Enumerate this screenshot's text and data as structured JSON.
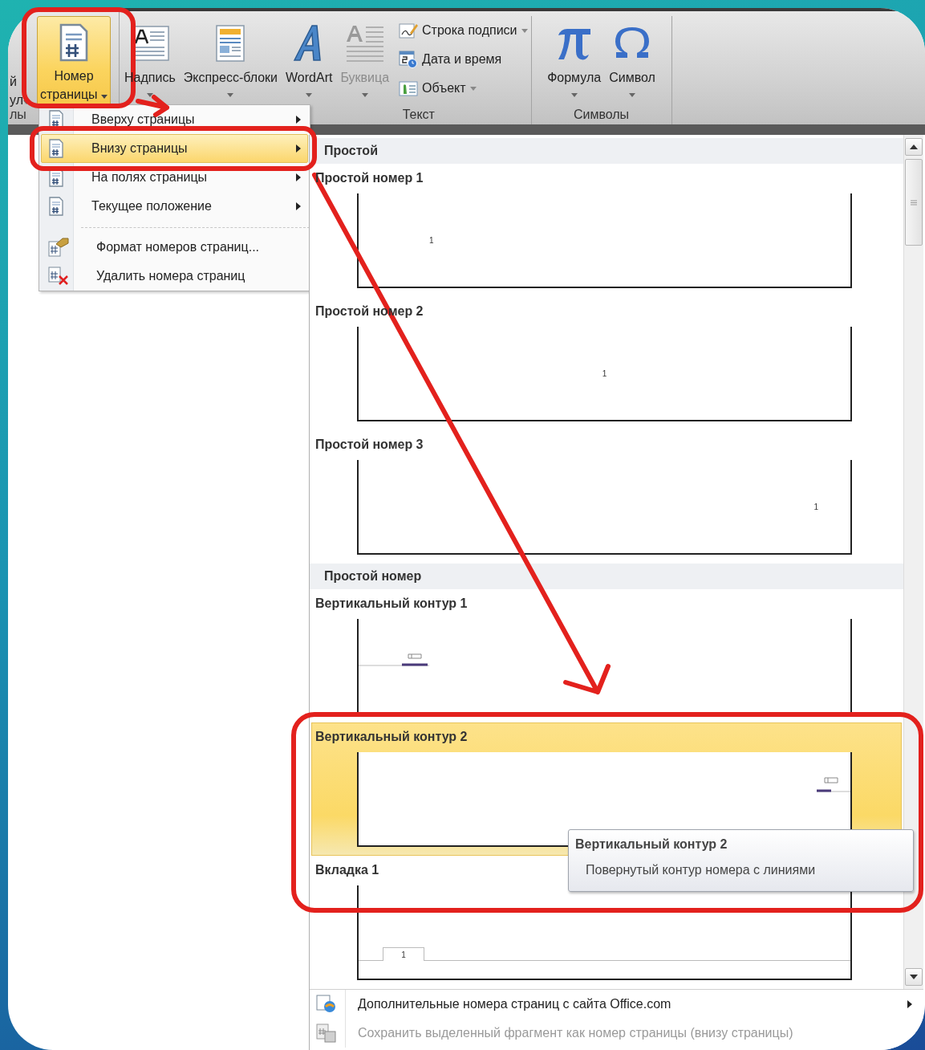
{
  "ribbon": {
    "cut_group": {
      "lines": [
        "й",
        "ул"
      ],
      "label": "лы"
    },
    "text_group": {
      "label": "Текст",
      "buttons": [
        {
          "label_lines": [
            "Номер",
            "страницы"
          ],
          "kind": "page-number",
          "selected": true,
          "disabled": false,
          "has_menu": true
        },
        {
          "label_lines": [
            "Надпись"
          ],
          "kind": "text-box",
          "selected": false,
          "disabled": false,
          "has_menu": true
        },
        {
          "label_lines": [
            "Экспресс-блоки"
          ],
          "kind": "quick-parts",
          "selected": false,
          "disabled": false,
          "has_menu": true
        },
        {
          "label_lines": [
            "WordArt"
          ],
          "kind": "wordart",
          "selected": false,
          "disabled": false,
          "has_menu": true
        },
        {
          "label_lines": [
            "Буквица"
          ],
          "kind": "drop-cap",
          "selected": false,
          "disabled": true,
          "has_menu": true
        }
      ],
      "small_buttons": [
        {
          "label": "Строка подписи",
          "kind": "signature",
          "has_menu": true
        },
        {
          "label": "Дата и время",
          "kind": "date-time",
          "has_menu": false
        },
        {
          "label": "Объект",
          "kind": "object",
          "has_menu": true
        }
      ]
    },
    "symbols_group": {
      "label": "Символы",
      "buttons": [
        {
          "label": "Формула",
          "kind": "equation",
          "has_menu": true
        },
        {
          "label": "Символ",
          "kind": "symbol",
          "has_menu": true
        }
      ]
    }
  },
  "page_number_menu": {
    "groups": [
      [
        {
          "label": "Вверху страницы",
          "kind": "top",
          "selected": false,
          "submenu": true
        },
        {
          "label": "Внизу страницы",
          "kind": "bottom",
          "selected": true,
          "submenu": true
        },
        {
          "label": "На полях страницы",
          "kind": "margins",
          "selected": false,
          "submenu": true
        },
        {
          "label": "Текущее положение",
          "kind": "current",
          "selected": false,
          "submenu": true
        }
      ],
      [
        {
          "label": "Формат номеров страниц...",
          "kind": "format",
          "selected": false,
          "submenu": false
        },
        {
          "label": "Удалить номера страниц",
          "kind": "remove",
          "selected": false,
          "submenu": false
        }
      ]
    ]
  },
  "gallery": {
    "sections": [
      {
        "header": "Простой",
        "items": [
          {
            "title": "Простой номер 1",
            "kind": "left",
            "number": "1",
            "selected": false
          },
          {
            "title": "Простой номер 2",
            "kind": "center",
            "number": "1",
            "selected": false
          },
          {
            "title": "Простой номер 3",
            "kind": "right",
            "number": "1",
            "selected": false
          }
        ]
      },
      {
        "header": "Простой номер",
        "items": [
          {
            "title": "Вертикальный контур 1",
            "kind": "outline-left",
            "selected": false
          },
          {
            "title": "Вертикальный контур 2",
            "kind": "outline-right",
            "selected": true
          },
          {
            "title": "Вкладка 1",
            "kind": "tab",
            "number": "1",
            "selected": false
          }
        ]
      }
    ],
    "tooltip": {
      "title": "Вертикальный контур 2",
      "description": "Повернутый контур номера с линиями"
    },
    "footer": [
      {
        "label": "Дополнительные номера страниц с сайта Office.com",
        "kind": "online",
        "disabled": false,
        "submenu": true
      },
      {
        "label": "Сохранить выделенный фрагмент как номер страницы (внизу страницы)",
        "kind": "save",
        "disabled": true,
        "submenu": false
      }
    ]
  }
}
